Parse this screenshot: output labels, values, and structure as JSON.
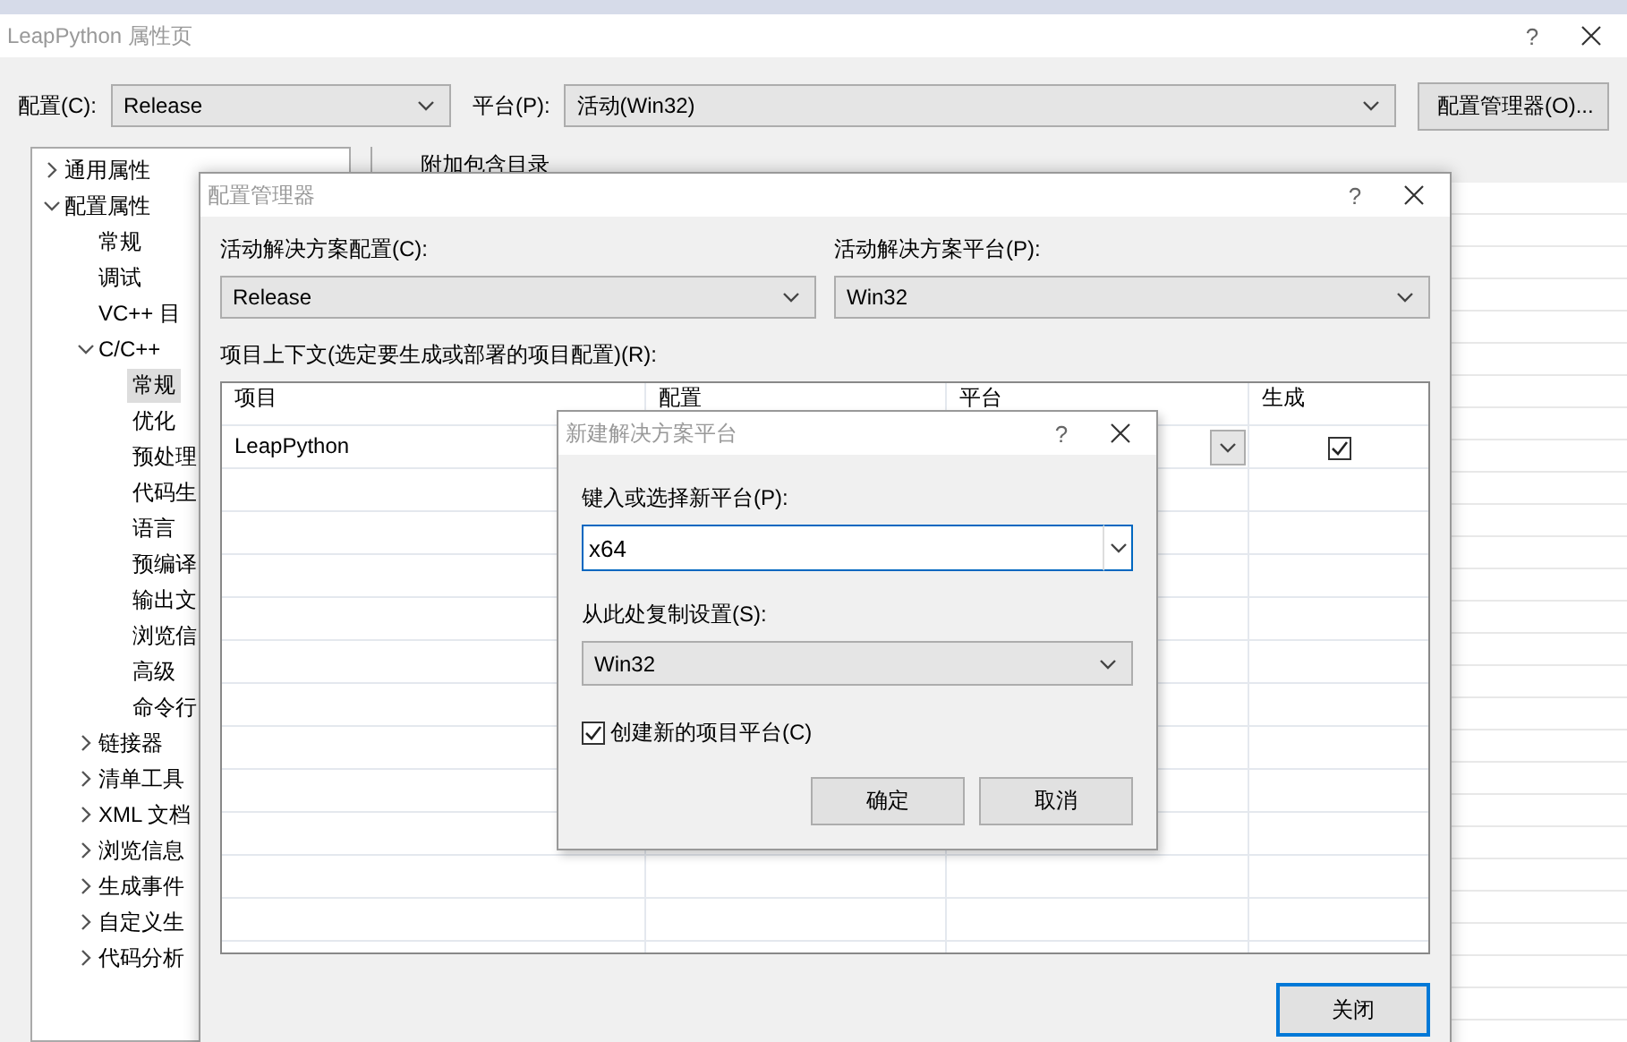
{
  "main_window": {
    "title": "LeapPython 属性页",
    "help": "?",
    "config_label": "配置(C):",
    "config_value": "Release",
    "platform_label": "平台(P):",
    "platform_value": "活动(Win32)",
    "config_manager_button": "配置管理器(O)..."
  },
  "tree": [
    {
      "label": "通用属性",
      "expanded": false,
      "selected": false
    },
    {
      "label": "配置属性",
      "expanded": true,
      "selected": false,
      "children": [
        {
          "label": "常规",
          "selected": false
        },
        {
          "label": "调试",
          "selected": false
        },
        {
          "label": "VC++ 目",
          "selected": false
        },
        {
          "label": "C/C++",
          "expanded": true,
          "selected": false,
          "children": [
            {
              "label": "常规",
              "selected": true
            },
            {
              "label": "优化",
              "selected": false
            },
            {
              "label": "预处理",
              "selected": false
            },
            {
              "label": "代码生",
              "selected": false
            },
            {
              "label": "语言",
              "selected": false
            },
            {
              "label": "预编译",
              "selected": false
            },
            {
              "label": "输出文",
              "selected": false
            },
            {
              "label": "浏览信",
              "selected": false
            },
            {
              "label": "高级",
              "selected": false
            },
            {
              "label": "命令行",
              "selected": false
            }
          ]
        },
        {
          "label": "链接器",
          "expanded": false,
          "selected": false
        },
        {
          "label": "清单工具",
          "expanded": false,
          "selected": false
        },
        {
          "label": "XML 文档",
          "expanded": false,
          "selected": false
        },
        {
          "label": "浏览信息",
          "expanded": false,
          "selected": false
        },
        {
          "label": "生成事件",
          "expanded": false,
          "selected": false
        },
        {
          "label": "自定义生",
          "expanded": false,
          "selected": false
        },
        {
          "label": "代码分析",
          "expanded": false,
          "selected": false
        }
      ]
    }
  ],
  "property_header": "附加包含目录",
  "config_manager": {
    "title": "配置管理器",
    "help": "?",
    "active_config_label": "活动解决方案配置(C):",
    "active_config_value": "Release",
    "active_platform_label": "活动解决方案平台(P):",
    "active_platform_value": "Win32",
    "context_label": "项目上下文(选定要生成或部署的项目配置)(R):",
    "columns": [
      "项目",
      "配置",
      "平台",
      "生成"
    ],
    "rows": [
      {
        "project": "LeapPython",
        "build": true
      }
    ],
    "close_button": "关闭"
  },
  "new_platform_dialog": {
    "title": "新建解决方案平台",
    "help": "?",
    "platform_label": "键入或选择新平台(P):",
    "platform_value": "x64",
    "copy_label": "从此处复制设置(S):",
    "copy_value": "Win32",
    "create_project_platforms": {
      "label": "创建新的项目平台(C)",
      "checked": true
    },
    "buttons": [
      "确定",
      "取消"
    ]
  }
}
